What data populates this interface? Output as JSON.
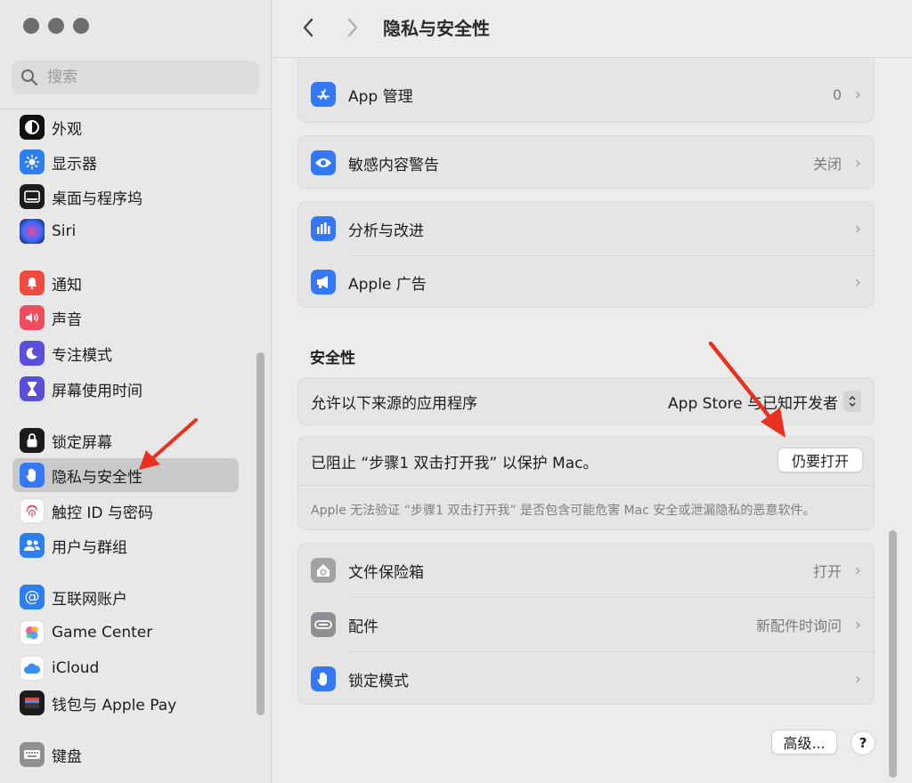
{
  "sidebar": {
    "search_placeholder": "搜索",
    "items": [
      {
        "label": "外观",
        "icon": "appearance-icon",
        "color": "#111111"
      },
      {
        "label": "显示器",
        "icon": "display-icon",
        "color": "#2d7ff0"
      },
      {
        "label": "桌面与程序坞",
        "icon": "dock-icon",
        "color": "#1c1c1e"
      },
      {
        "label": "Siri",
        "icon": "siri-icon",
        "color": "#3a2a6b"
      },
      {
        "label": "通知",
        "icon": "notification-icon",
        "color": "#f04b3f"
      },
      {
        "label": "声音",
        "icon": "sound-icon",
        "color": "#f04b5f"
      },
      {
        "label": "专注模式",
        "icon": "focus-icon",
        "color": "#5a4fd9"
      },
      {
        "label": "屏幕使用时间",
        "icon": "screen-time-icon",
        "color": "#5a4fd9"
      },
      {
        "label": "锁定屏幕",
        "icon": "lock-icon",
        "color": "#1c1c1e"
      },
      {
        "label": "隐私与安全性",
        "icon": "hand-icon",
        "color": "#3478f6",
        "selected": true
      },
      {
        "label": "触控 ID 与密码",
        "icon": "fingerprint-icon",
        "color": "#ffffff"
      },
      {
        "label": "用户与群组",
        "icon": "users-icon",
        "color": "#2d7ff0"
      },
      {
        "label": "互联网账户",
        "icon": "at-icon",
        "color": "#2d7ff0"
      },
      {
        "label": "Game Center",
        "icon": "game-center-icon",
        "color": "#ffffff"
      },
      {
        "label": "iCloud",
        "icon": "icloud-icon",
        "color": "#ffffff"
      },
      {
        "label": "钱包与 Apple Pay",
        "icon": "wallet-icon",
        "color": "#1c1c1e"
      },
      {
        "label": "键盘",
        "icon": "keyboard-icon",
        "color": "#8e8e93"
      }
    ]
  },
  "toolbar": {
    "title": "隐私与安全性"
  },
  "rows": {
    "app_management": {
      "label": "App 管理",
      "value": "0"
    },
    "sensitive": {
      "label": "敏感内容警告",
      "value": "关闭"
    },
    "analytics": {
      "label": "分析与改进"
    },
    "apple_ads": {
      "label": "Apple 广告"
    },
    "filevault": {
      "label": "文件保险箱",
      "value": "打开"
    },
    "accessories": {
      "label": "配件",
      "value": "新配件时询问"
    },
    "lockdown": {
      "label": "锁定模式"
    }
  },
  "security": {
    "title": "安全性",
    "allow_label": "允许以下来源的应用程序",
    "allow_value": "App Store 与已知开发者",
    "blocked_message": "已阻止 “步骤1 双击打开我” 以保护 Mac。",
    "open_anyway": "仍要打开",
    "description": "Apple 无法验证 “步骤1 双击打开我” 是否包含可能危害 Mac 安全或泄漏隐私的恶意软件。"
  },
  "footer": {
    "advanced": "高级...",
    "help": "?"
  },
  "colors": {
    "annotation_arrow": "#e8321f",
    "accent": "#3478f6"
  }
}
